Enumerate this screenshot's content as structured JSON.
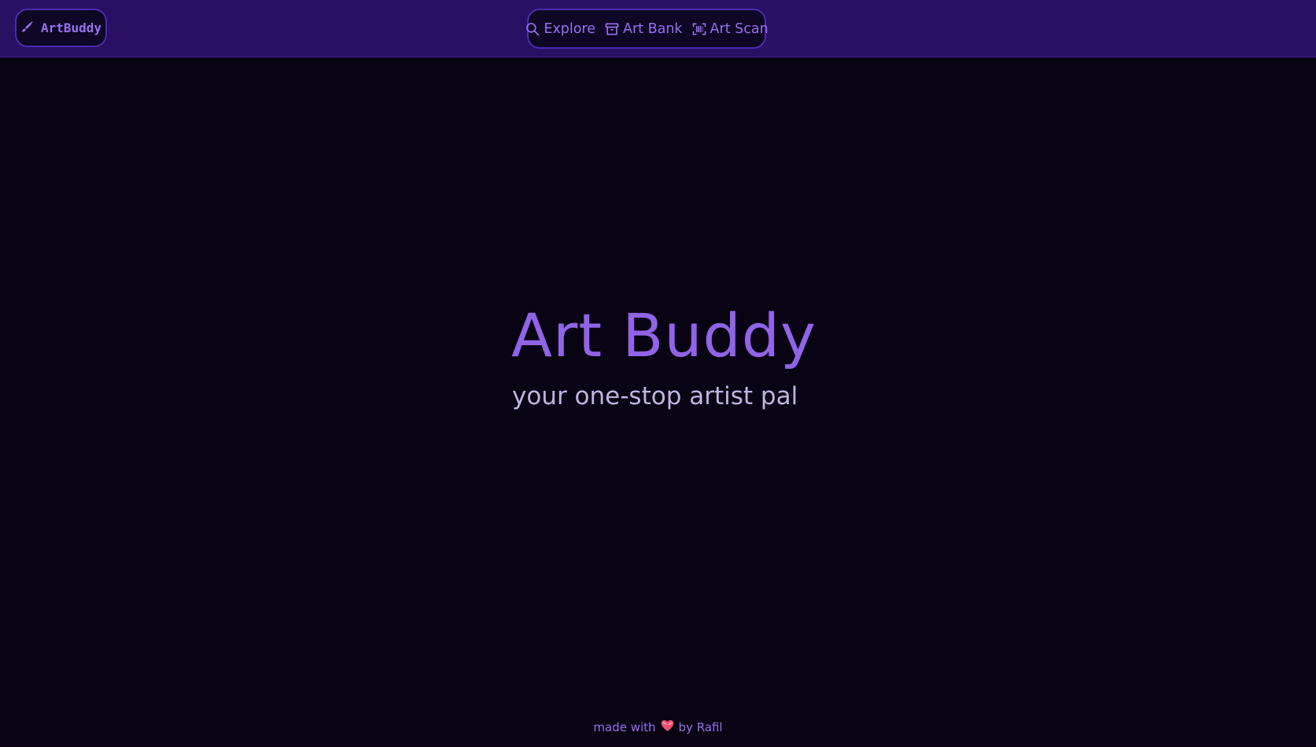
{
  "header": {
    "brand_label": "ArtBuddy",
    "brand_icon": "brush-icon",
    "nav": [
      {
        "label": "Explore",
        "icon": "search-icon"
      },
      {
        "label": "Art Bank",
        "icon": "archive-icon"
      },
      {
        "label": "Art Scan",
        "icon": "scan-icon"
      }
    ]
  },
  "hero": {
    "title": "Art Buddy",
    "subtitle": "your one-stop artist pal"
  },
  "footer": {
    "prefix": "made with",
    "heart_icon": "heart-icon",
    "suffix": "by Rafil"
  },
  "colors": {
    "background": "#080414",
    "topbar": "#291062",
    "accent": "#9163e6",
    "subtitle": "#c2b3df"
  }
}
